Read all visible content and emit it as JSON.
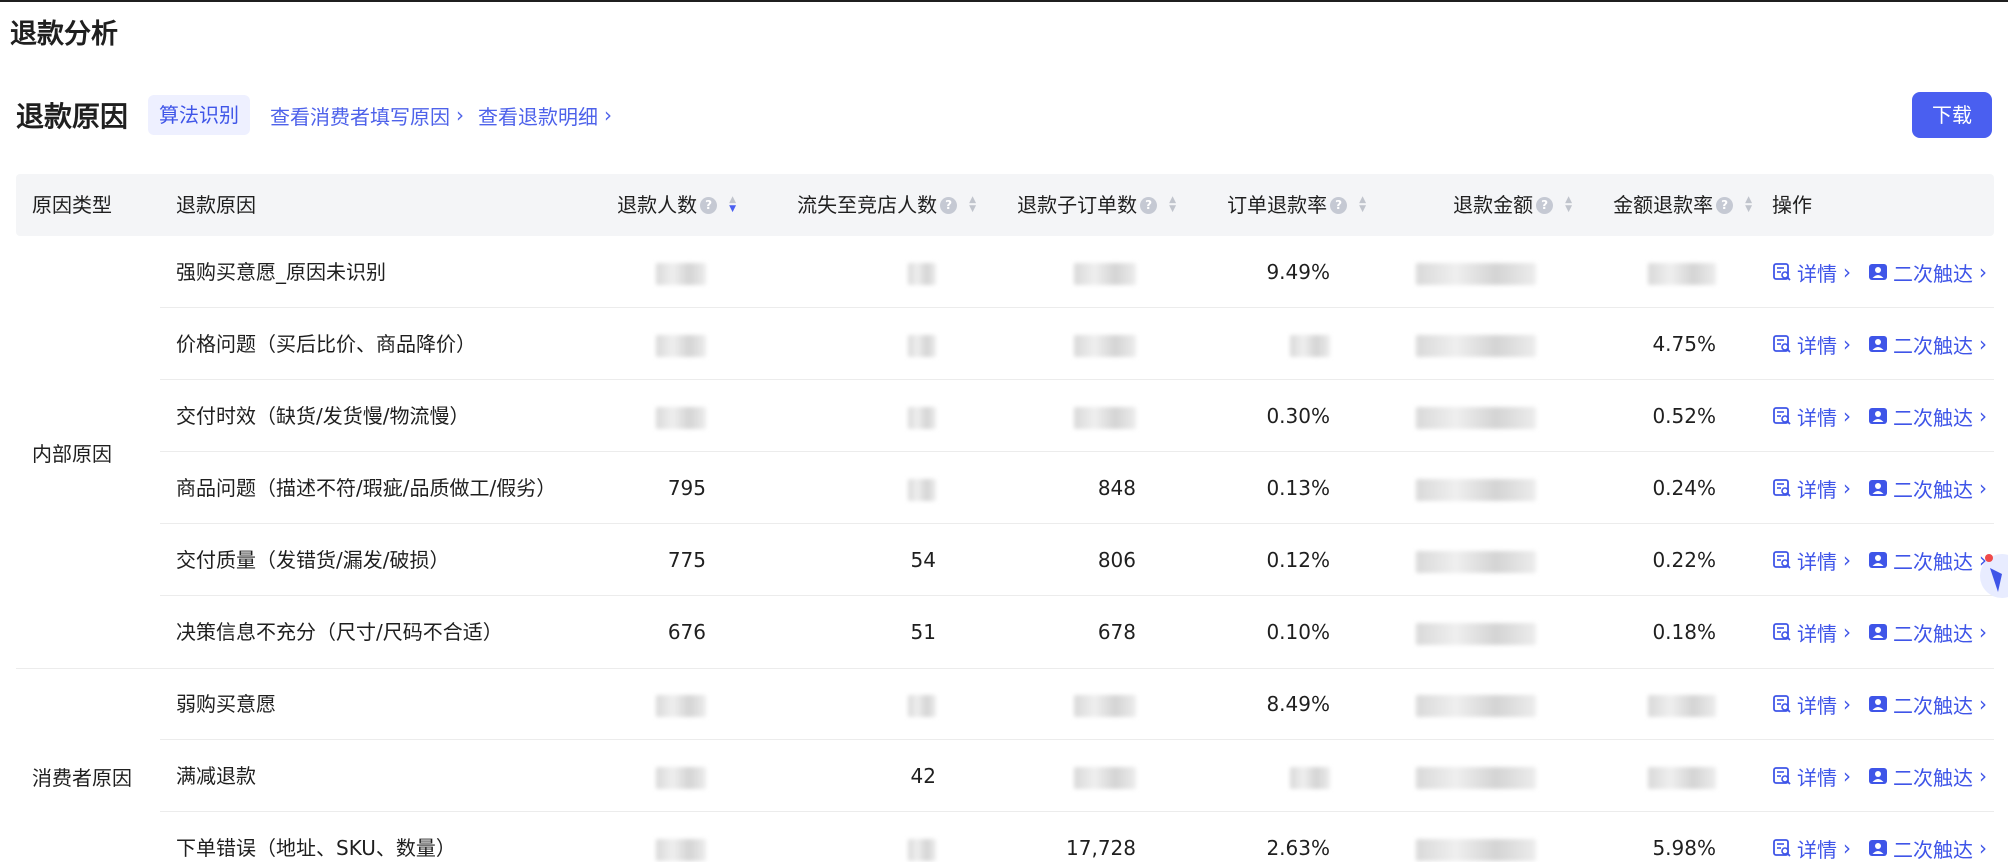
{
  "page": {
    "title": "退款分析"
  },
  "section": {
    "title": "退款原因",
    "tag": "算法识别",
    "link_consumer": "查看消费者填写原因",
    "link_detail": "查看退款明细",
    "download": "下载"
  },
  "table": {
    "headers": {
      "type": "原因类型",
      "reason": "退款原因",
      "people": "退款人数",
      "lost": "流失至竞店人数",
      "suborders": "退款子订单数",
      "order_rate": "订单退款率",
      "amount": "退款金额",
      "amount_rate": "金额退款率",
      "ops": "操作"
    },
    "groups": [
      {
        "name": "内部原因"
      },
      {
        "name": "消费者原因"
      }
    ],
    "rows": [
      {
        "reason": "强购买意愿_原因未识别",
        "people": "",
        "lost": "",
        "suborders": "",
        "order_rate": "9.49%",
        "amount": "",
        "amount_rate": ""
      },
      {
        "reason": "价格问题（买后比价、商品降价）",
        "people": "",
        "lost": "",
        "suborders": "",
        "order_rate": "",
        "amount": "",
        "amount_rate": "4.75%"
      },
      {
        "reason": "交付时效（缺货/发货慢/物流慢）",
        "people": "",
        "lost": "",
        "suborders": "",
        "order_rate": "0.30%",
        "amount": "",
        "amount_rate": "0.52%"
      },
      {
        "reason": "商品问题（描述不符/瑕疵/品质做工/假劣）",
        "people": "795",
        "lost": "",
        "suborders": "848",
        "order_rate": "0.13%",
        "amount": "",
        "amount_rate": "0.24%"
      },
      {
        "reason": "交付质量（发错货/漏发/破损）",
        "people": "775",
        "lost": "54",
        "suborders": "806",
        "order_rate": "0.12%",
        "amount": "",
        "amount_rate": "0.22%"
      },
      {
        "reason": "决策信息不充分（尺寸/尺码不合适）",
        "people": "676",
        "lost": "51",
        "suborders": "678",
        "order_rate": "0.10%",
        "amount": "",
        "amount_rate": "0.18%"
      },
      {
        "reason": "弱购买意愿",
        "people": "",
        "lost": "",
        "suborders": "",
        "order_rate": "8.49%",
        "amount": "",
        "amount_rate": ""
      },
      {
        "reason": "满减退款",
        "people": "",
        "lost": "42",
        "suborders": "",
        "order_rate": "",
        "amount": "",
        "amount_rate": ""
      },
      {
        "reason": "下单错误（地址、SKU、数量）",
        "people": "",
        "lost": "",
        "suborders": "17,728",
        "order_rate": "2.63%",
        "amount": "",
        "amount_rate": "5.98%"
      }
    ],
    "op_detail": "详情",
    "op_touch": "二次触达"
  },
  "colors": {
    "accent": "#4a5ff0",
    "link": "#4e62ea",
    "header_bg": "#f4f5f7"
  },
  "icons": {
    "detail": "document-search-icon",
    "touch": "user-contact-icon",
    "help": "question-circle-icon",
    "sort": "sort-caret-icon"
  }
}
